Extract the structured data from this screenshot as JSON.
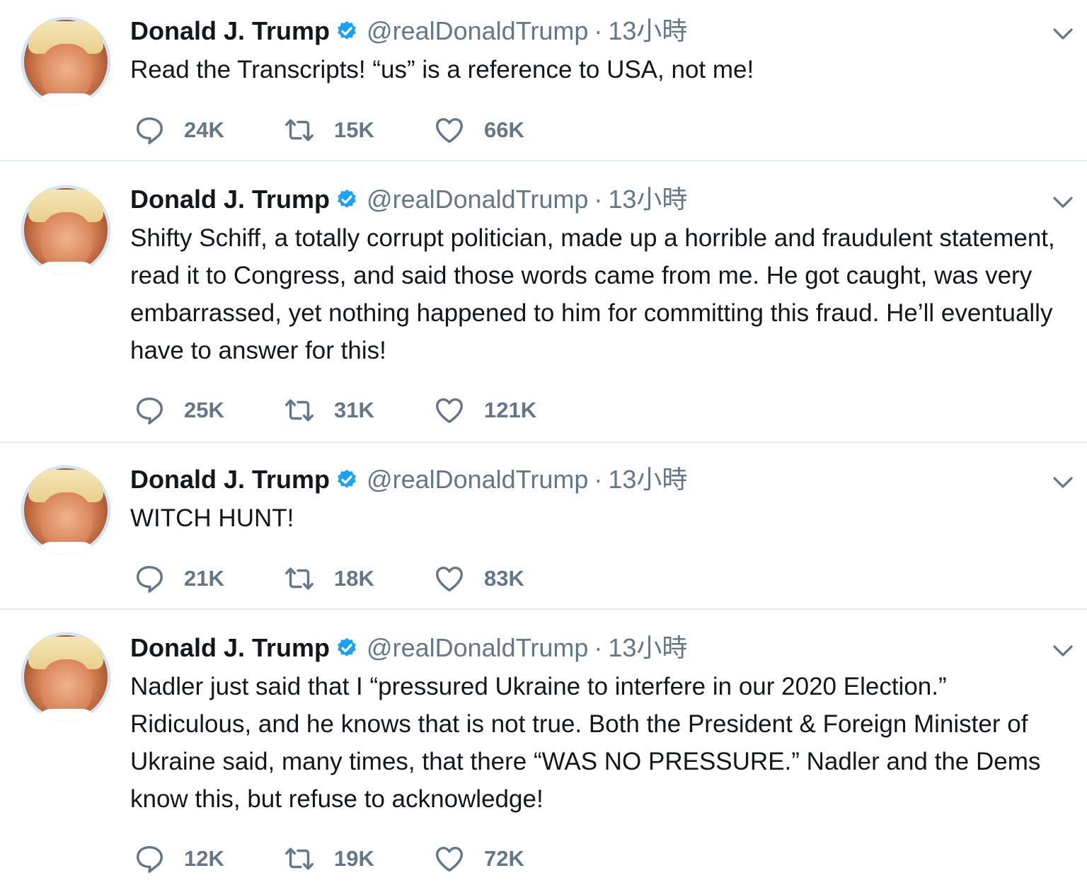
{
  "tweets": [
    {
      "name": "Donald J. Trump",
      "handle": "@realDonaldTrump",
      "dot": "·",
      "time": "13小時",
      "text": "Read the Transcripts! “us” is a reference to USA, not me!",
      "replies": "24K",
      "retweets": "15K",
      "likes": "66K"
    },
    {
      "name": "Donald J. Trump",
      "handle": "@realDonaldTrump",
      "dot": "·",
      "time": "13小時",
      "text": "Shifty Schiff, a totally corrupt politician, made up a horrible and fraudulent statement, read it to Congress, and said those words came from me. He got caught, was very embarrassed, yet nothing happened to him for committing this fraud. He’ll eventually have to answer for this!",
      "replies": "25K",
      "retweets": "31K",
      "likes": "121K"
    },
    {
      "name": "Donald J. Trump",
      "handle": "@realDonaldTrump",
      "dot": "·",
      "time": "13小時",
      "text": "WITCH HUNT!",
      "replies": "21K",
      "retweets": "18K",
      "likes": "83K"
    },
    {
      "name": "Donald J. Trump",
      "handle": "@realDonaldTrump",
      "dot": "·",
      "time": "13小時",
      "text": "Nadler just said that I “pressured Ukraine to interfere in our 2020 Election.” Ridiculous, and he knows that is not true. Both the President & Foreign Minister of Ukraine said, many times, that there “WAS NO PRESSURE.” Nadler and the Dems know this, but refuse to acknowledge!",
      "replies": "12K",
      "retweets": "19K",
      "likes": "72K"
    }
  ],
  "icons": {
    "verified": "verified-badge-icon",
    "chevron": "chevron-down-icon",
    "reply": "reply-icon",
    "retweet": "retweet-icon",
    "like": "heart-icon"
  },
  "colors": {
    "verified": "#1da1f2",
    "secondary_text": "#657786",
    "divider": "#e6ecf0"
  }
}
